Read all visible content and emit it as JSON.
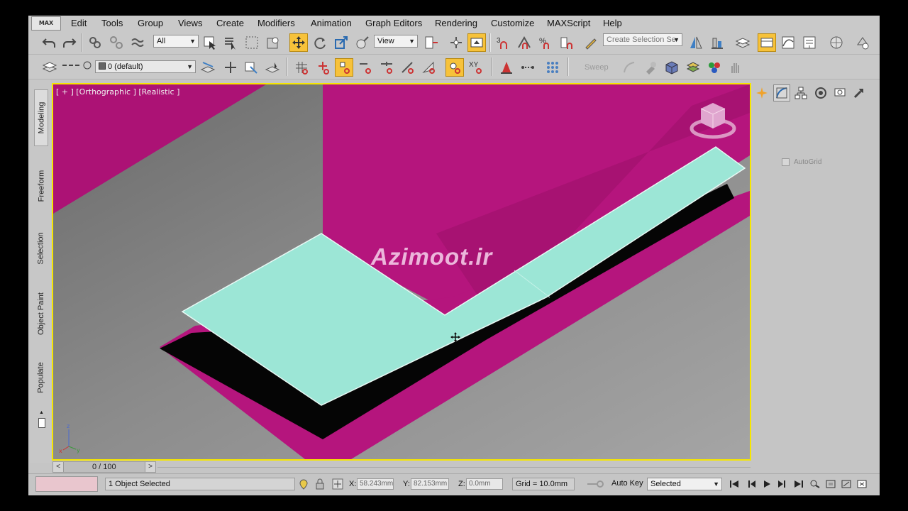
{
  "menu": {
    "logo": "MAX",
    "items": [
      "Edit",
      "Tools",
      "Group",
      "Views",
      "Create",
      "Modifiers",
      "Animation",
      "Graph Editors",
      "Rendering",
      "Customize",
      "MAXScript",
      "Help"
    ]
  },
  "toolbar": {
    "selection_filter": "All",
    "reference_coord": "View",
    "snap_labels": [
      "3",
      "%"
    ],
    "named_selection_placeholder": "Create Selection Se",
    "layer_dropdown": "0 (default)",
    "xy_label": "XY",
    "sweep_label": "Sweep"
  },
  "ribbon": {
    "tabs": [
      "Modeling",
      "Freeform",
      "Selection",
      "Object Paint",
      "Populate"
    ]
  },
  "viewport": {
    "label": "[ + ] [Orthographic ] [Realistic ]",
    "watermark": "Azimoot.ir",
    "background_color": "#858585",
    "magenta_color": "#b5157d",
    "shape_color": "#9ce6d6",
    "border_color": "#f6e600"
  },
  "command_panel": {
    "autogrid_label": "AutoGrid"
  },
  "timeslider": {
    "value": "0 / 100",
    "prev": "<",
    "next": ">"
  },
  "status": {
    "selection_text": "1 Object Selected",
    "x_label": "X:",
    "x_value": "58.243mm",
    "y_label": "Y:",
    "y_value": "82.153mm",
    "z_label": "Z:",
    "z_value": "0.0mm",
    "grid": "Grid = 10.0mm",
    "autokey": "Auto Key",
    "key_filter": "Selected"
  }
}
